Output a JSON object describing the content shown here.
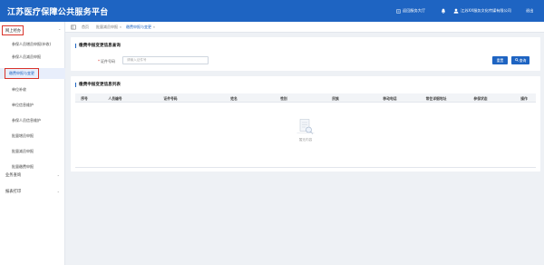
{
  "header": {
    "title": "江苏医疗保障公共服务平台",
    "home_link": "返回服务大厅",
    "org_name": "江苏XX服务文化传媒有限公司",
    "exit": "退出"
  },
  "sidebar": {
    "groups": [
      {
        "label": "网上经办"
      },
      {
        "label": "业务查询"
      },
      {
        "label": "报表打印"
      }
    ],
    "items": [
      {
        "label": "参保人员增员申报(补收)"
      },
      {
        "label": "参保人员减员申报"
      },
      {
        "label": "缴费申报与变更"
      },
      {
        "label": "单位补收"
      },
      {
        "label": "单位信息维护"
      },
      {
        "label": "参保人员信息维护"
      },
      {
        "label": "批量增员申报"
      },
      {
        "label": "批量减员申报"
      },
      {
        "label": "批量缴费申报"
      }
    ]
  },
  "tabs": [
    {
      "label": "首页"
    },
    {
      "label": "批量减员申报"
    },
    {
      "label": "缴费申报与变更"
    }
  ],
  "query_panel": {
    "title": "缴费申报变更信息查询",
    "field_label": "证件号码",
    "field_placeholder": "请输入证件号",
    "reset_label": "重置",
    "query_label": "查询"
  },
  "list_panel": {
    "title": "缴费申报变更信息列表",
    "columns": [
      "序号",
      "人员编号",
      "证件号码",
      "姓名",
      "性别",
      "民族",
      "移动电话",
      "常住详细地址",
      "参保状态",
      "操作"
    ],
    "empty_text": "暂无内容"
  },
  "colors": {
    "header_bg": "#1e64c2",
    "accent": "#1e64c2",
    "highlight_outline": "#d9342b"
  },
  "icons": {
    "home": "home-icon",
    "bell": "bell-icon",
    "user": "user-icon",
    "search": "search-icon",
    "menu_toggle": "menu-toggle-icon",
    "empty": "empty-data-icon"
  }
}
